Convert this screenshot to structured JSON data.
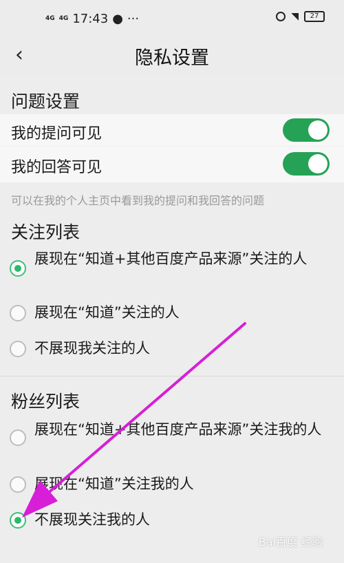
{
  "statusbar": {
    "signal1": "4G",
    "signal2": "4G",
    "time": "17:43",
    "battery": "27"
  },
  "nav": {
    "title": "隐私设置"
  },
  "question_settings": {
    "header": "问题设置",
    "items": [
      {
        "label": "我的提问可见",
        "enabled": true
      },
      {
        "label": "我的回答可见",
        "enabled": true
      }
    ],
    "hint": "可以在我的个人主页中看到我的提问和我回答的问题"
  },
  "follow_list": {
    "header": "关注列表",
    "options": [
      {
        "label": "展现在“知道+其他百度产品来源”关注的人",
        "selected": true
      },
      {
        "label": "展现在“知道”关注的人",
        "selected": false
      },
      {
        "label": "不展现我关注的人",
        "selected": false
      }
    ]
  },
  "fans_list": {
    "header": "粉丝列表",
    "options": [
      {
        "label": "展现在“知道+其他百度产品来源”关注我的人",
        "selected": false
      },
      {
        "label": "展现在“知道”关注我的人",
        "selected": false
      },
      {
        "label": "不展现关注我的人",
        "selected": true
      }
    ]
  },
  "watermark": "Bai百度 经验",
  "colors": {
    "accent": "#25a255",
    "annotation": "#d61fd6"
  }
}
